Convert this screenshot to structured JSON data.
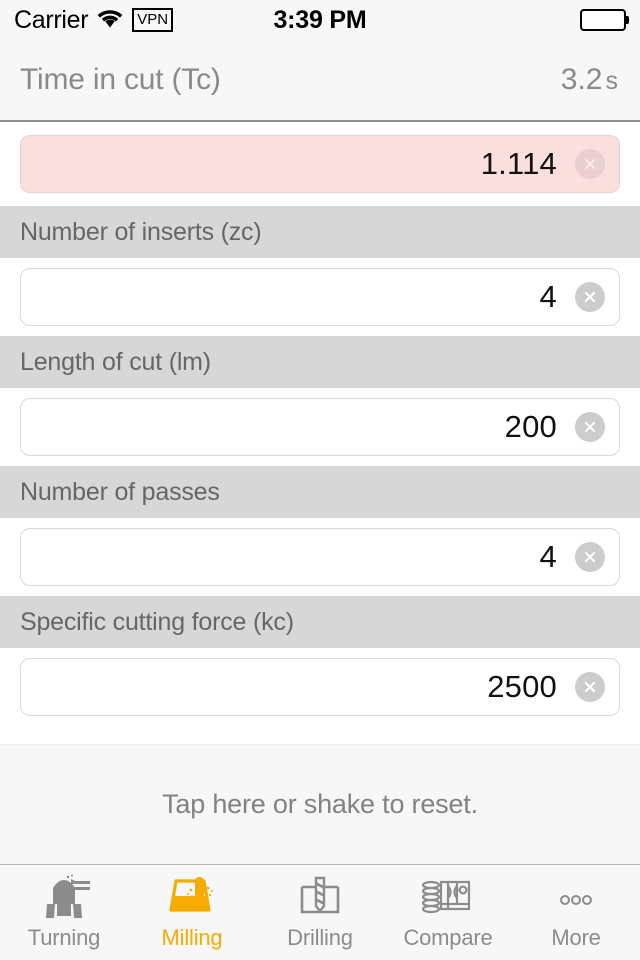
{
  "status_bar": {
    "carrier": "Carrier",
    "wifi_icon": "wifi-icon",
    "vpn_badge": "VPN",
    "time": "3:39 PM",
    "battery_icon": "battery-full-icon"
  },
  "header": {
    "title": "Time in cut (Tc)",
    "value": "3.2",
    "unit": "s"
  },
  "form": {
    "fields": [
      {
        "label": "",
        "value": "1.114",
        "state": "error",
        "clear_icon": "clear-circle-icon"
      },
      {
        "label": "Number of inserts (zc)",
        "value": "4",
        "state": "normal",
        "clear_icon": "clear-circle-icon"
      },
      {
        "label": "Length of cut (lm)",
        "value": "200",
        "state": "normal",
        "clear_icon": "clear-circle-icon"
      },
      {
        "label": "Number of passes",
        "value": "4",
        "state": "normal",
        "clear_icon": "clear-circle-icon"
      },
      {
        "label": "Specific cutting force (kc)",
        "value": "2500",
        "state": "normal",
        "clear_icon": "clear-circle-icon"
      }
    ]
  },
  "reset": {
    "text": "Tap here or shake to reset."
  },
  "tab_bar": {
    "active_index": 1,
    "active_color": "#f5ab00",
    "inactive_color": "#8c8c8c",
    "items": [
      {
        "label": "Turning",
        "icon": "turning-icon"
      },
      {
        "label": "Milling",
        "icon": "milling-icon"
      },
      {
        "label": "Drilling",
        "icon": "drilling-icon"
      },
      {
        "label": "Compare",
        "icon": "compare-icon"
      },
      {
        "label": "More",
        "icon": "more-dots-icon"
      }
    ]
  }
}
